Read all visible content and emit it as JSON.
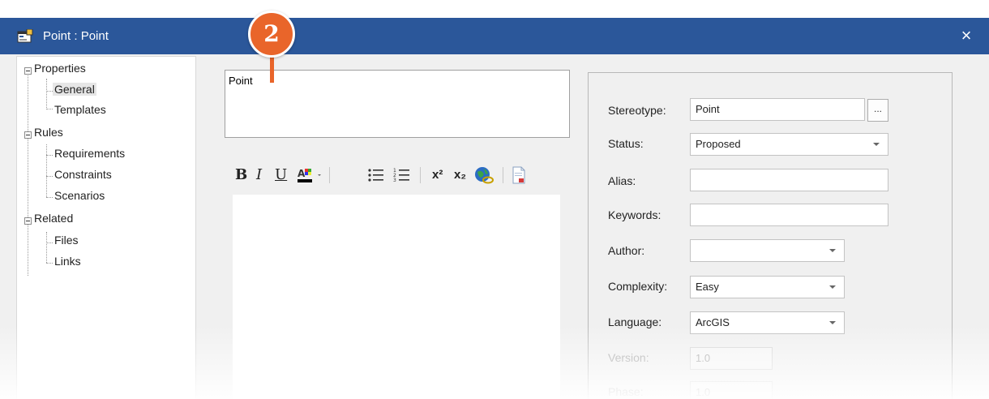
{
  "window": {
    "title": "Point : Point",
    "close_glyph": "×"
  },
  "tree": {
    "nodes": [
      {
        "label": "Properties",
        "level": 0
      },
      {
        "label": "General",
        "level": 1,
        "selected": true
      },
      {
        "label": "Templates",
        "level": 1
      },
      {
        "label": "Rules",
        "level": 0
      },
      {
        "label": "Requirements",
        "level": 1
      },
      {
        "label": "Constraints",
        "level": 1
      },
      {
        "label": "Scenarios",
        "level": 1
      },
      {
        "label": "Related",
        "level": 0
      },
      {
        "label": "Files",
        "level": 1
      },
      {
        "label": "Links",
        "level": 1
      }
    ]
  },
  "name_field": {
    "value": "Point"
  },
  "toolbar": {
    "bold": "B",
    "italic": "I",
    "underline": "U",
    "superscript": "x²",
    "subscript": "x₂"
  },
  "properties": {
    "stereotype": {
      "label": "Stereotype:",
      "value": "Point",
      "button": "..."
    },
    "status": {
      "label": "Status:",
      "value": "Proposed"
    },
    "alias": {
      "label": "Alias:",
      "value": ""
    },
    "keywords": {
      "label": "Keywords:",
      "value": ""
    },
    "author": {
      "label": "Author:",
      "value": ""
    },
    "complexity": {
      "label": "Complexity:",
      "value": "Easy"
    },
    "language": {
      "label": "Language:",
      "value": "ArcGIS"
    },
    "version": {
      "label": "Version:",
      "value": "1.0"
    },
    "phase": {
      "label": "Phase:",
      "value": "1.0"
    }
  },
  "callout": {
    "number": "2"
  },
  "colors": {
    "titlebar": "#2b579a",
    "callout": "#e9652a"
  }
}
